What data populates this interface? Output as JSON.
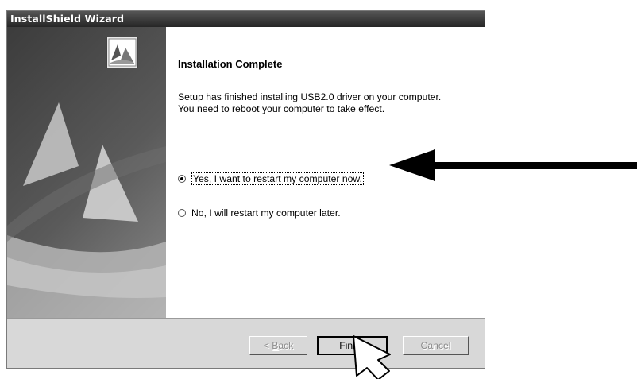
{
  "window": {
    "title": "InstallShield Wizard"
  },
  "page": {
    "heading": "Installation Complete",
    "message_lines": [
      "Setup has finished installing USB2.0 driver on your computer.",
      "You need to reboot your computer to take effect."
    ]
  },
  "options": [
    {
      "label": "Yes, I want to restart my computer now.",
      "selected": true
    },
    {
      "label": "No, I will restart my computer later.",
      "selected": false
    }
  ],
  "buttons": {
    "back": {
      "prefix": "< ",
      "mnemonic": "B",
      "rest": "ack",
      "enabled": false
    },
    "finish": {
      "label": "Finish",
      "enabled": true
    },
    "cancel": {
      "label": "Cancel",
      "enabled": false
    }
  },
  "annotation": {
    "type": "arrow",
    "color": "#000000"
  },
  "colors": {
    "titlebar": "#262626",
    "dialog": "#d8d8d8",
    "content": "#ffffff"
  }
}
